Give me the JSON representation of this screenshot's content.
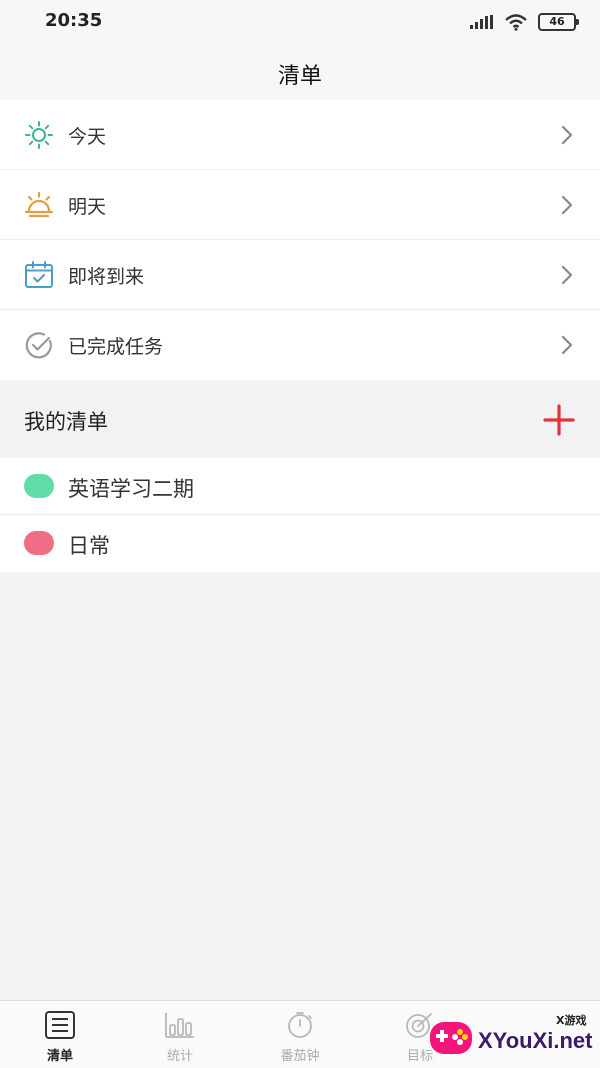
{
  "status_bar": {
    "time": "20:35",
    "battery": "46"
  },
  "header": {
    "title": "清单"
  },
  "smart_lists": [
    {
      "label": "今天",
      "icon": "sun-icon"
    },
    {
      "label": "明天",
      "icon": "sunrise-icon"
    },
    {
      "label": "即将到来",
      "icon": "calendar-icon"
    },
    {
      "label": "已完成任务",
      "icon": "check-circle-icon"
    }
  ],
  "my_lists": {
    "title": "我的清单",
    "add_icon": "plus-icon",
    "items": [
      {
        "label": "英语学习二期",
        "color": "#5fdca7"
      },
      {
        "label": "日常",
        "color": "#ee6e86"
      }
    ]
  },
  "bottom_nav": [
    {
      "label": "清单",
      "icon": "list-icon",
      "active": true
    },
    {
      "label": "统计",
      "icon": "bar-chart-icon",
      "active": false
    },
    {
      "label": "番茄钟",
      "icon": "stopwatch-icon",
      "active": false
    },
    {
      "label": "目标",
      "icon": "target-icon",
      "active": false
    }
  ],
  "watermark": {
    "small": "X游戏",
    "big": "XYouXi.net"
  },
  "colors": {
    "sun": "#3bb39b",
    "sunrise": "#e0a23d",
    "calendar": "#4a9fc9",
    "check": "#9a9a9a",
    "add": "#e0353a"
  }
}
